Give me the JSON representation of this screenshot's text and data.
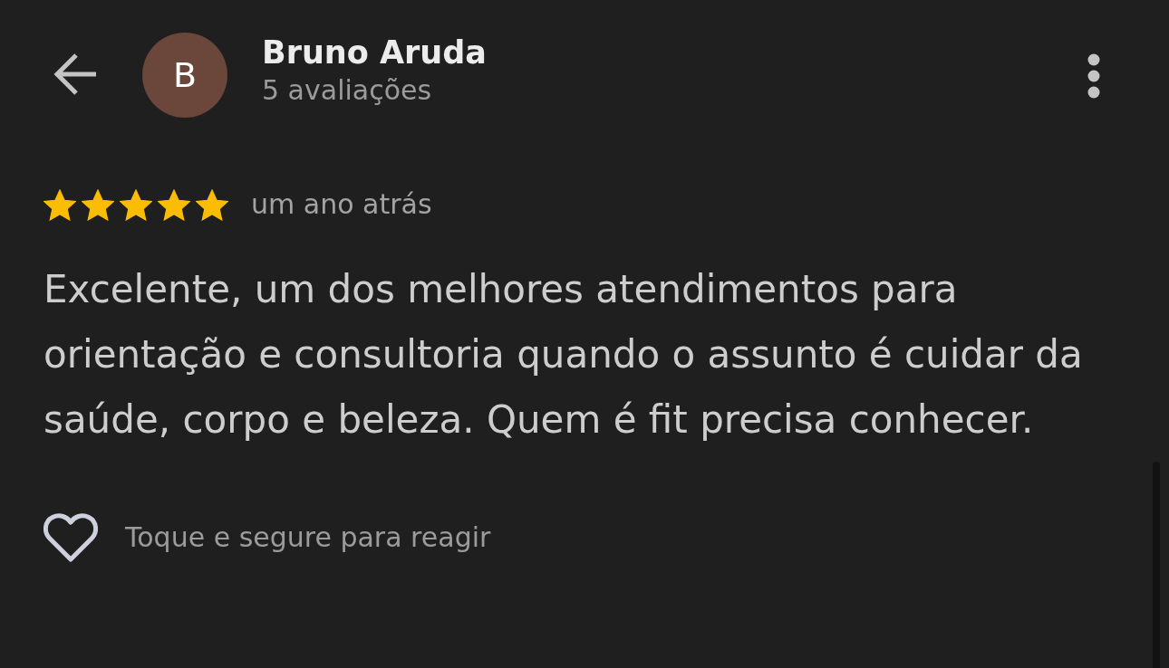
{
  "reviewer": {
    "avatar_initial": "B",
    "name": "Bruno Aruda",
    "review_count": "5 avaliações"
  },
  "review": {
    "stars": 5,
    "time": "um ano atrás",
    "text": "Excelente, um dos melhores atendimentos para orientação e consultoria quando o assunto é cuidar da saúde, corpo e beleza. Quem é fit precisa conhecer."
  },
  "reaction": {
    "hint": "Toque e segure para reagir"
  }
}
